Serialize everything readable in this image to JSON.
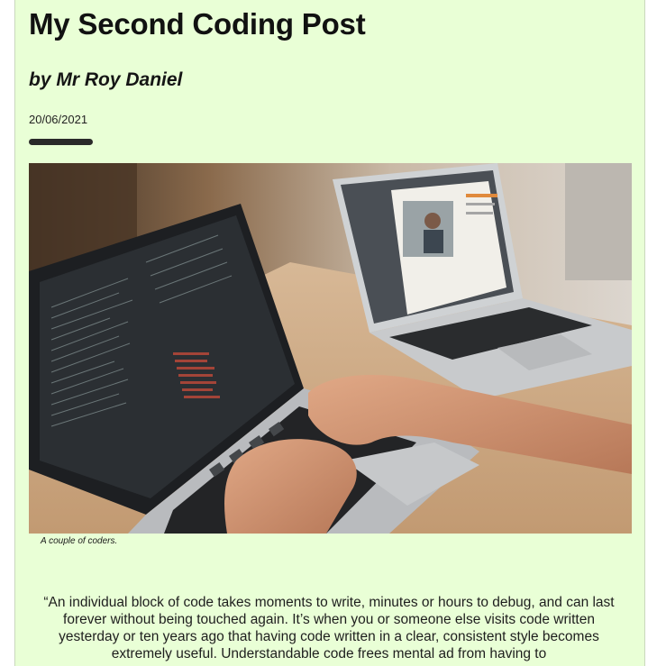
{
  "post": {
    "title": "My Second Coding Post",
    "byline": "by Mr Roy Daniel",
    "date": "20/06/2021"
  },
  "figure": {
    "caption": "A couple of coders.",
    "image_icon": "photo-laptops-coding"
  },
  "body": {
    "quote": "“An individual block of code takes moments to write, minutes or hours to debug, and can last forever without being touched again. It’s when you or someone else visits code written yesterday or ten years ago that having code written in a clear, consistent style becomes extremely useful. Understandable code frees mental ad from having to"
  },
  "colors": {
    "page_background": "#e9ffd6",
    "outer_background": "#ffffff",
    "accent_bar": "#2a2a2a",
    "text": "#111111"
  }
}
